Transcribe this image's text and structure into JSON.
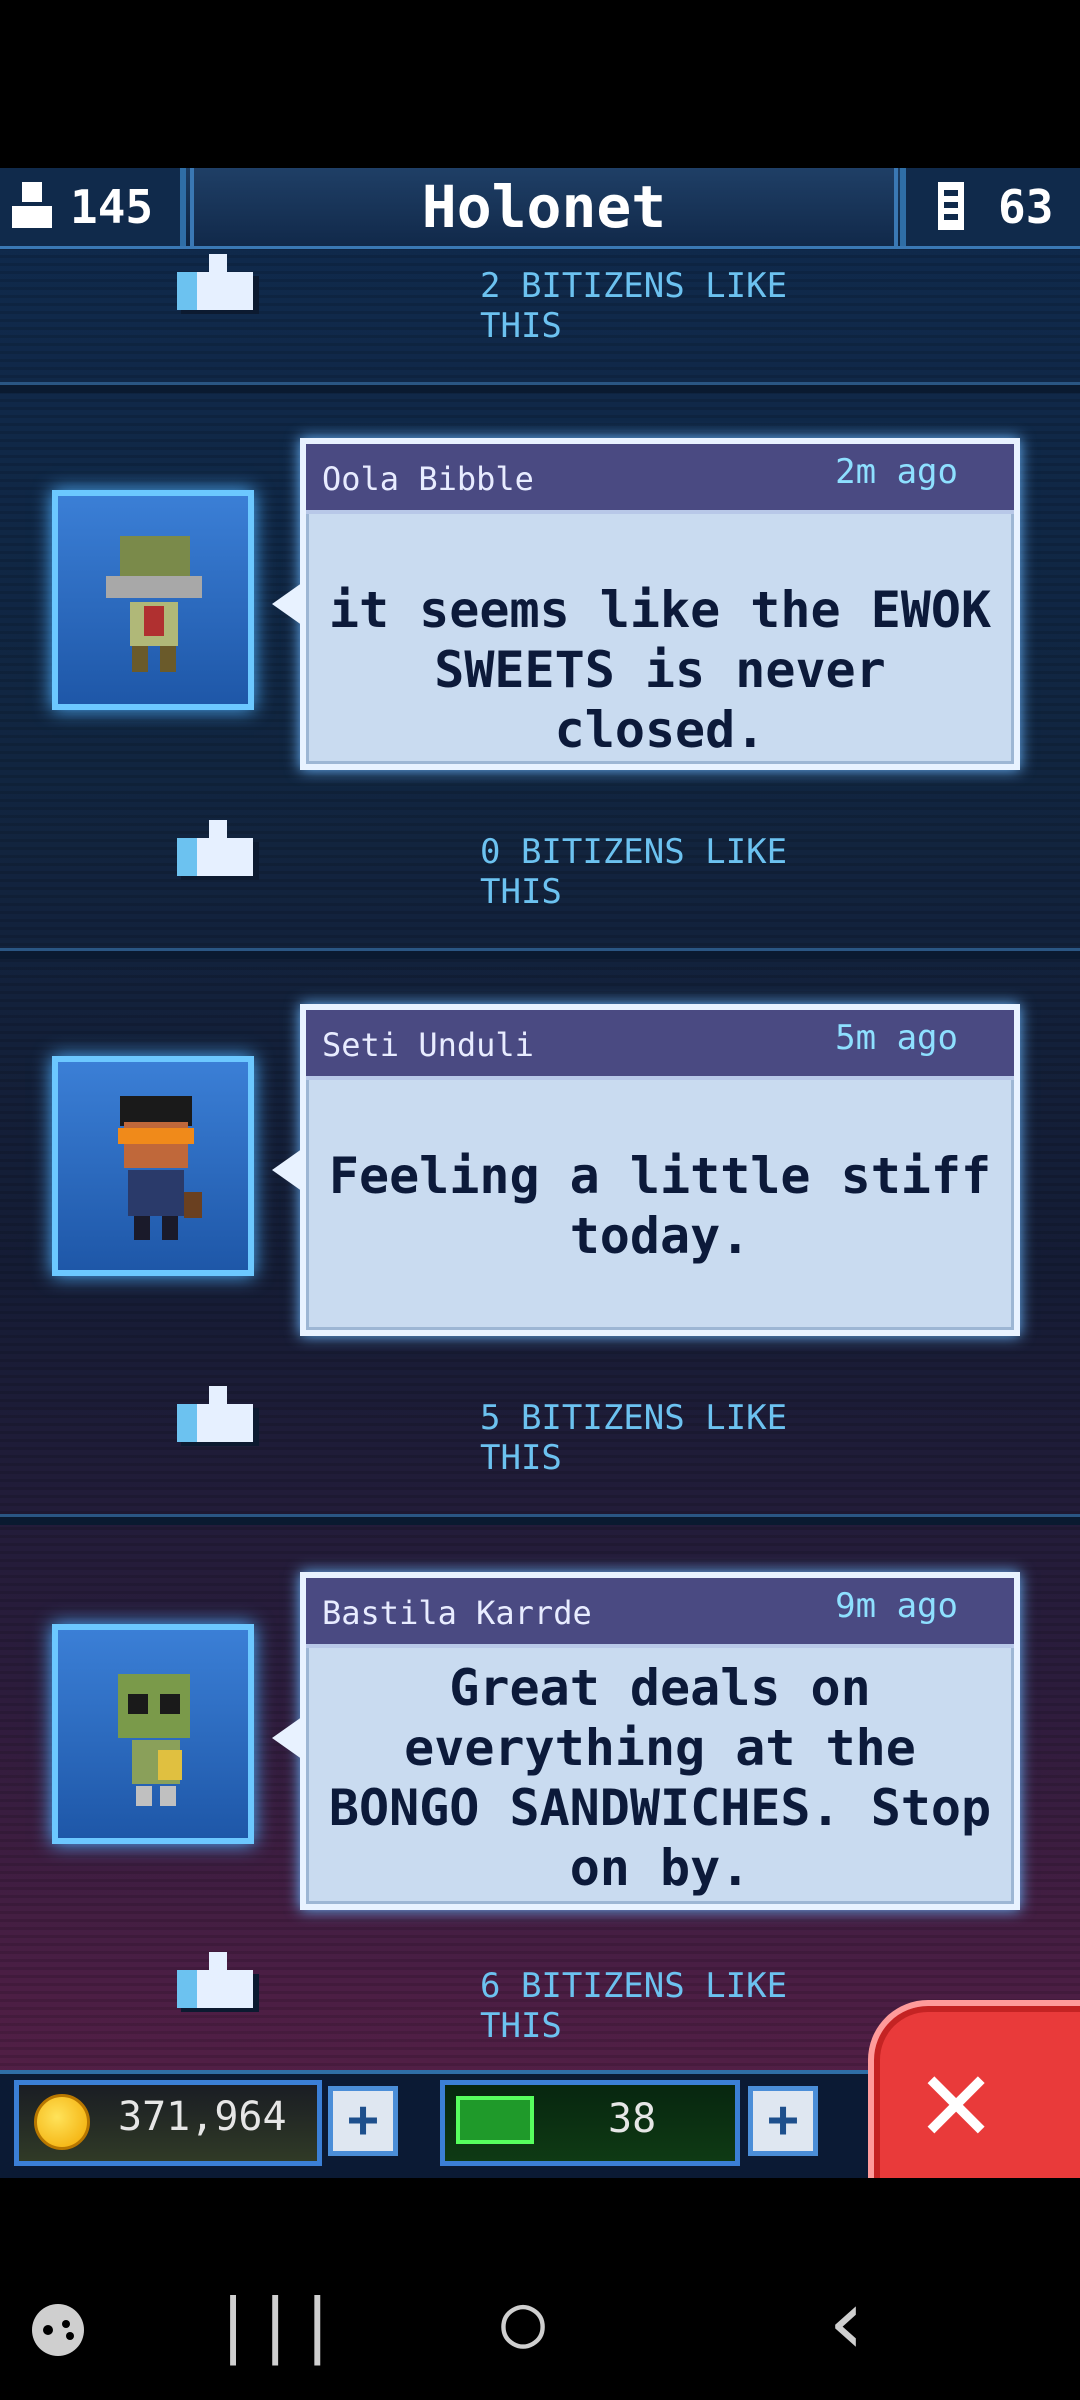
{
  "header": {
    "population": "145",
    "title": "Holonet",
    "floors": "63"
  },
  "feed": [
    {
      "likes_label": "2 BITIZENS LIKE THIS"
    },
    {
      "name": "Oola Bibble",
      "time": "2m ago",
      "message": "it seems like the EWOK SWEETS is never closed.",
      "likes_label": "0 BITIZENS LIKE THIS"
    },
    {
      "name": "Seti Unduli",
      "time": "5m ago",
      "message": "Feeling a little stiff today.",
      "likes_label": "5 BITIZENS LIKE THIS"
    },
    {
      "name": "Bastila Karrde",
      "time": "9m ago",
      "message": "Great deals on everything at the BONGO SANDWICHES. Stop on by.",
      "likes_label": "6 BITIZENS LIKE THIS"
    }
  ],
  "currency": {
    "coins": "371,964",
    "bux": "38",
    "plus": "+",
    "close": "✕"
  },
  "nav": {
    "back": "‹",
    "home": "◯",
    "recents": "|||"
  }
}
